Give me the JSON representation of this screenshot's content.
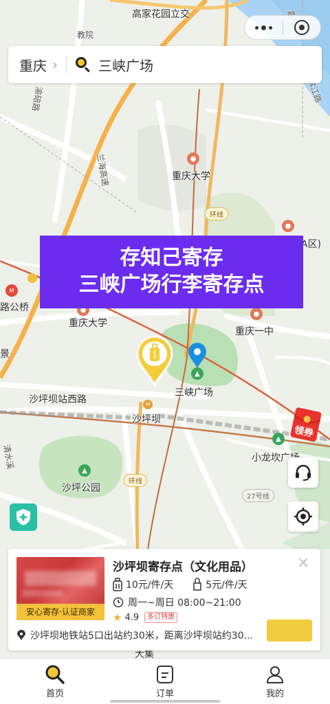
{
  "map": {
    "labels": {
      "gaojia": "高家花园立交",
      "jiaoyu": "教院",
      "road_right_top": "嘉陵路",
      "road_right": "滨江路",
      "yuqi": "渝碚路",
      "lanhai": "兰海高速",
      "cqu_top": "重庆大学",
      "cqu_a": "A区)",
      "cqu_mid": "重庆大学",
      "cq_yizhong": "重庆一中",
      "gongqiao": "路公桥",
      "jing": "景",
      "sanxia_map": "三峡广场",
      "shapingba_west": "沙坪坝站西路",
      "shapingba": "沙坪坝",
      "xiaolongkan": "小龙坎广场",
      "shaping_park": "沙坪公园",
      "qingshui": "清水溪",
      "dajixie": "大集",
      "ring1": "环线",
      "ring2": "环线",
      "rd27": "27号线"
    }
  },
  "capsule": {
    "more": "more-icon",
    "close": "close-target-icon"
  },
  "search": {
    "city": "重庆",
    "query": "三峡广场"
  },
  "banner": {
    "line1": "存知己寄存",
    "line2": "三峡广场行李寄存点",
    "color": "#6c2cf0"
  },
  "coupon": {
    "label": "领券"
  },
  "card": {
    "title": "沙坪坝寄存点（文化用品）",
    "image_tag": "安心寄存·认证商家",
    "price_small": "10元/件/天",
    "price_bag": "5元/件/天",
    "hours": "周一~周日 08:00~21:00",
    "rating": "4.9",
    "rating_tag": "多订特惠",
    "address": "沙坪坝地铁站5口出站约30米，距离沙坪坝站约30...",
    "close": "×"
  },
  "tabs": [
    {
      "label": "首页",
      "icon": "search-icon"
    },
    {
      "label": "订单",
      "icon": "order-icon"
    },
    {
      "label": "我的",
      "icon": "user-icon"
    }
  ],
  "colors": {
    "accent": "#f2cc3f",
    "banner": "#6c2cf0",
    "teal": "#2bbfa6",
    "pin_blue": "#1a8fe0"
  }
}
